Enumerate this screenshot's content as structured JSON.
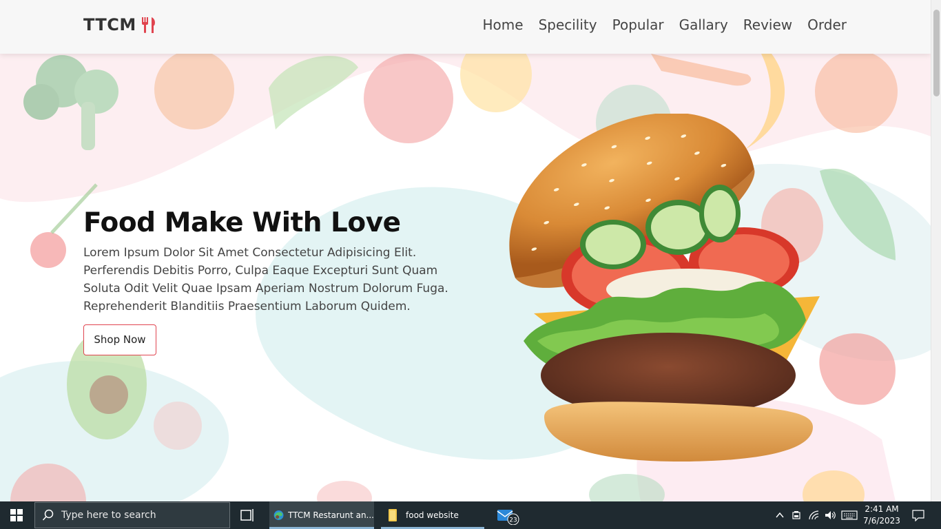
{
  "header": {
    "logo_text": "TTCM",
    "nav": [
      "Home",
      "Specility",
      "Popular",
      "Gallary",
      "Review",
      "Order"
    ]
  },
  "hero": {
    "title": "Food Make With Love",
    "description": "Lorem Ipsum Dolor Sit Amet Consectetur Adipisicing Elit. Perferendis Debitis Porro, Culpa Eaque Excepturi Sunt Quam Soluta Odit Velit Quae Ipsam Aperiam Nostrum Dolorum Fuga. Reprehenderit Blanditiis Praesentium Laborum Quidem.",
    "button_label": "Shop Now"
  },
  "taskbar": {
    "search_placeholder": "Type here to search",
    "apps": [
      {
        "label": "TTCM Restarunt an...",
        "icon": "edge-browser-icon"
      },
      {
        "label": "food website",
        "icon": "folder-icon"
      }
    ],
    "mail_badge": "23",
    "time": "2:41 AM",
    "date": "7/6/2023"
  },
  "colors": {
    "accent": "#e0444f",
    "logo_icon": "#e0444f",
    "taskbar": "#1f2a30"
  }
}
